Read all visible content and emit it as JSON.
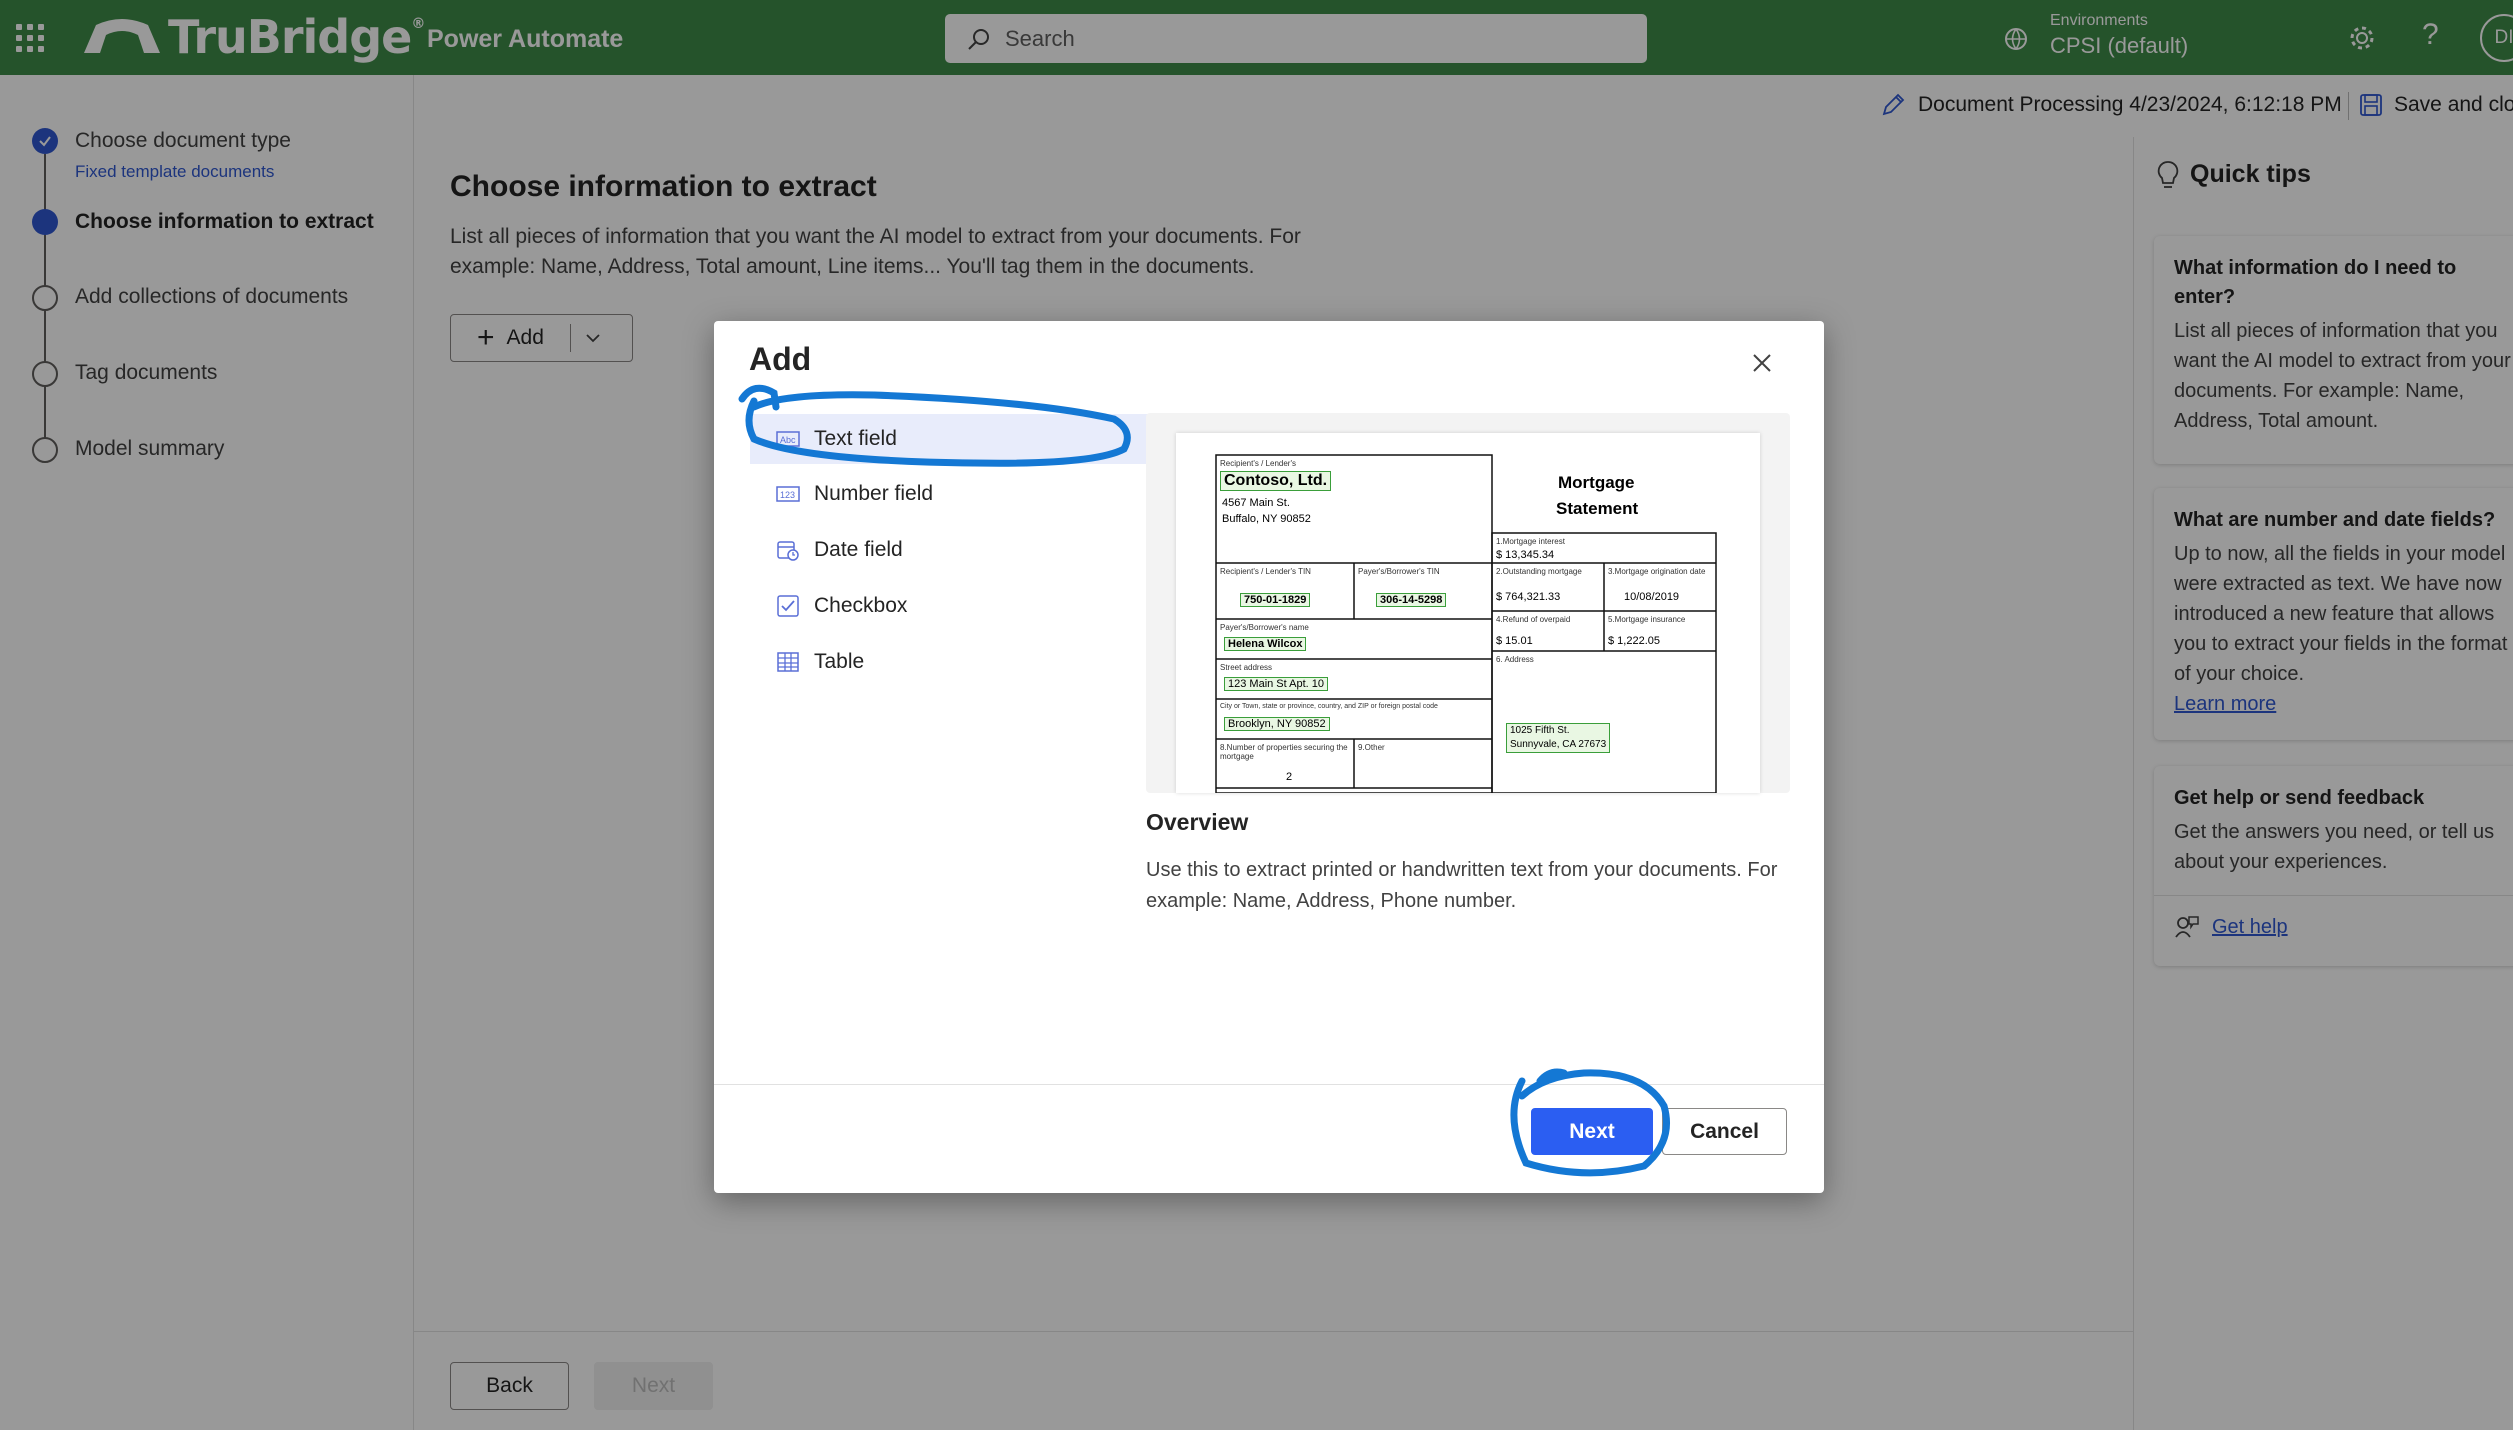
{
  "header": {
    "brand": "TruBridge",
    "brand_mark": "®",
    "app_name": "Power Automate",
    "search_placeholder": "Search",
    "env_label": "Environments",
    "env_value": "CPSI (default)",
    "avatar_initials": "DI",
    "help_glyph": "?",
    "colors": {
      "bar": "#3f8a49",
      "accent": "#2f58d1"
    }
  },
  "subbar": {
    "doc_title": "Document Processing 4/23/2024, 6:12:18 PM",
    "save_label": "Save and clo"
  },
  "stepper": {
    "steps": [
      {
        "label": "Choose document type",
        "sub": "Fixed template documents",
        "state": "done"
      },
      {
        "label": "Choose information to extract",
        "state": "current"
      },
      {
        "label": "Add collections of documents",
        "state": "pending"
      },
      {
        "label": "Tag documents",
        "state": "pending"
      },
      {
        "label": "Model summary",
        "state": "pending"
      }
    ]
  },
  "main": {
    "title": "Choose information to extract",
    "description": "List all pieces of information that you want the AI model to extract from your documents. For example: Name, Address, Total amount, Line items... You'll tag them in the documents.",
    "add_label": "Add",
    "add_plus": "+",
    "back_label": "Back",
    "next_label": "Next"
  },
  "tips": {
    "title": "Quick tips",
    "cards": [
      {
        "title": "What information do I need to enter?",
        "body": "List all pieces of information that you want the AI model to extract from your documents. For example: Name, Address, Total amount."
      },
      {
        "title": "What are number and date fields?",
        "body": "Up to now, all the fields in your model were extracted as text. We have now introduced a new feature that allows you to extract your fields in the format of your choice.",
        "link": "Learn more"
      },
      {
        "title": "Get help or send feedback",
        "body": "Get the answers you need, or tell us about your experiences.",
        "link": "Get help"
      }
    ]
  },
  "dialog": {
    "title": "Add",
    "selected_type": "Text field",
    "types": [
      {
        "label": "Text field",
        "icon": "text-field-icon"
      },
      {
        "label": "Number field",
        "icon": "number-field-icon"
      },
      {
        "label": "Date field",
        "icon": "date-field-icon"
      },
      {
        "label": "Checkbox",
        "icon": "checkbox-icon"
      },
      {
        "label": "Table",
        "icon": "table-icon"
      }
    ],
    "preview": {
      "recipient_label": "Recipient's / Lender's",
      "company": "Contoso, Ltd.",
      "address1": "4567 Main St.",
      "address2": "Buffalo, NY 90852",
      "doc_title_line1": "Mortgage",
      "doc_title_line2": "Statement",
      "f1_label": "1.Mortgage interest",
      "f1_value": "$  13,345.34",
      "f2_label": "2.Outstanding mortgage",
      "f2_value": "$  764,321.33",
      "f3_label": "3.Mortgage origination date",
      "f3_value": "10/08/2019",
      "f4_label": "4.Refund of overpaid",
      "f4_value": "$  15.01",
      "f5_label": "5.Mortgage insurance",
      "f5_value": "$  1,222.05",
      "f6_label": "6. Address",
      "f6_value1": "1025 Fifth St.",
      "f6_value2": "Sunnyvale, CA 27673",
      "rtin_label": "Recipient's / Lender's TIN",
      "rtin_value": "750-01-1829",
      "ptin_label": "Payer's/Borrower's TIN",
      "ptin_value": "306-14-5298",
      "payer_label": "Payer's/Borrower's name",
      "payer_value": "Helena Wilcox",
      "street_label": "Street address",
      "street_value": "123 Main St Apt. 10",
      "city_label": "City or Town, state or province, country, and ZIP or foreign postal code",
      "city_value": "Brooklyn, NY 90852",
      "f8_label": "8.Number of properties securing the mortgage",
      "f8_value": "2",
      "f9_label": "9.Other"
    },
    "overview_title": "Overview",
    "overview_desc": "Use this to extract printed or handwritten text from your documents. For example: Name, Address, Phone number.",
    "next_label": "Next",
    "cancel_label": "Cancel"
  }
}
